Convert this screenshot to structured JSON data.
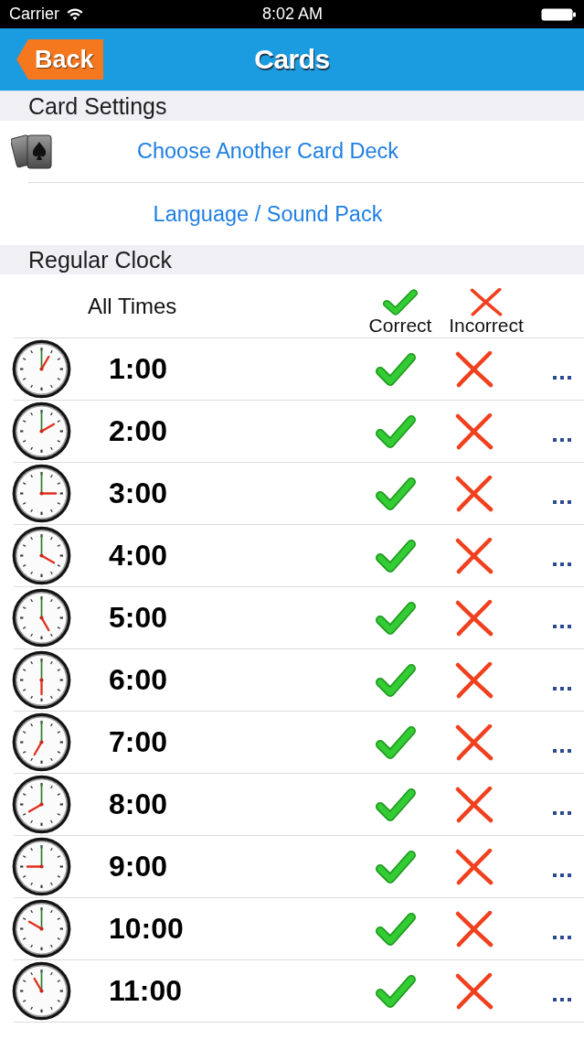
{
  "status_bar": {
    "carrier": "Carrier",
    "time": "8:02 AM"
  },
  "nav_bar": {
    "back_button": "Back",
    "title": "Cards"
  },
  "sections": [
    {
      "kind": "settings",
      "title": "Card Settings",
      "items": [
        {
          "kind": "deck",
          "label": "Choose Another Card Deck"
        },
        {
          "kind": "plain",
          "label": "Language / Sound Pack"
        }
      ]
    },
    {
      "kind": "clock",
      "title": "Regular Clock",
      "columns": {
        "label": "All Times",
        "correct": "Correct",
        "incorrect": "Incorrect"
      },
      "rows": [
        {
          "time": "1:00"
        },
        {
          "time": "2:00"
        },
        {
          "time": "3:00"
        },
        {
          "time": "4:00"
        },
        {
          "time": "5:00"
        },
        {
          "time": "6:00"
        },
        {
          "time": "7:00"
        },
        {
          "time": "8:00"
        },
        {
          "time": "9:00"
        },
        {
          "time": "10:00"
        },
        {
          "time": "11:00"
        }
      ]
    }
  ]
}
